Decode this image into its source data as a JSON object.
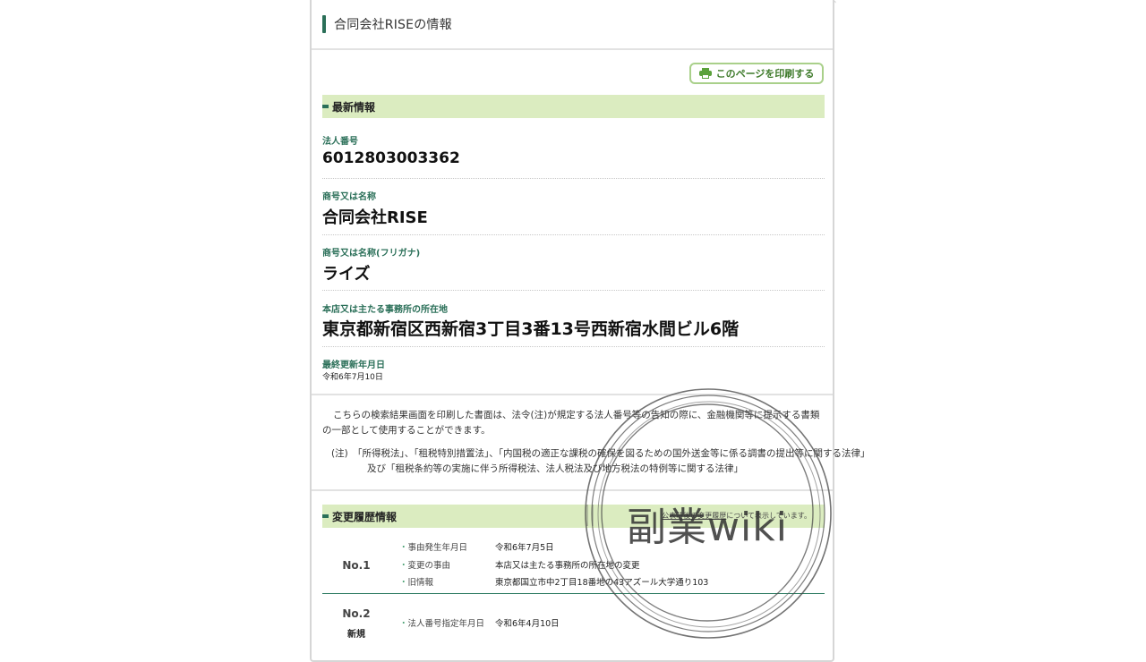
{
  "header": {
    "title": "合同会社RISEの情報"
  },
  "print_button": {
    "label": "このページを印刷する"
  },
  "latest": {
    "section_title": "最新情報",
    "corp_number_label": "法人番号",
    "corp_number": "6012803003362",
    "name_label": "商号又は名称",
    "name": "合同会社RISE",
    "furigana_label": "商号又は名称(フリガナ)",
    "furigana": "ライズ",
    "address_label": "本店又は主たる事務所の所在地",
    "address": "東京都新宿区西新宿3丁目3番13号西新宿水間ビル6階",
    "updated_label": "最終更新年月日",
    "updated": "令和6年7月10日"
  },
  "notice": {
    "para1": "こちらの検索結果画面を印刷した書面は、法令(注)が規定する法人番号等の告知の際に、金融機関等に提示する書類の一部として使用することができます。",
    "para2": "(注)　「所得税法」、「租税特別措置法」、「内国税の適正な課税の確保を図るための国外送金等に係る調書の提出等に関する法律」及び「租税条約等の実施に伴う所得税法、法人税法及び地方税法の特例等に関する法律」"
  },
  "history": {
    "section_title": "変更履歴情報",
    "note_link": "公表時後の変更履歴",
    "note_rest": "について表示しています。",
    "entries": [
      {
        "no": "No.1",
        "rows": [
          {
            "key": "事由発生年月日",
            "value": "令和6年7月5日"
          },
          {
            "key": "変更の事由",
            "value": "本店又は主たる事務所の所在地の変更"
          },
          {
            "key": "旧情報",
            "value": "東京都国立市中2丁目18番地の43アズール大学通り103"
          }
        ]
      },
      {
        "no": "No.2",
        "tag": "新規",
        "rows": [
          {
            "key": "法人番号指定年月日",
            "value": "令和6年4月10日"
          }
        ]
      }
    ]
  },
  "watermark": {
    "text": "副業wiki"
  }
}
